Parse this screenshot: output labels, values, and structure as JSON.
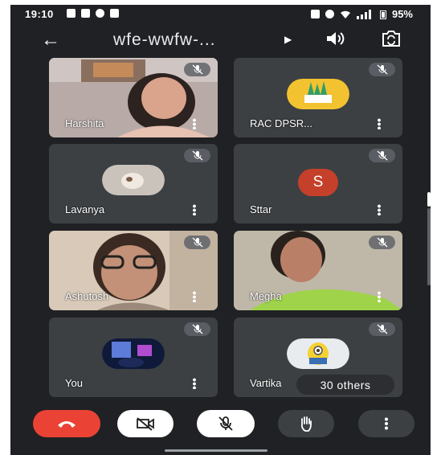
{
  "status_bar": {
    "time": "19:10",
    "battery": "95%"
  },
  "meeting": {
    "title": "wfe-wwfw-..."
  },
  "participants": [
    {
      "name": "Harshita"
    },
    {
      "name": "RAC DPSR..."
    },
    {
      "name": "Lavanya"
    },
    {
      "name": "Sttar",
      "avatar_letter": "S"
    },
    {
      "name": "Ashutosh"
    },
    {
      "name": "Megha"
    },
    {
      "name": "You"
    },
    {
      "name": "Vartika"
    }
  ],
  "others_label": "30 others",
  "colors": {
    "background": "#202124",
    "tile": "#3c4043",
    "end_call": "#ea4335",
    "avatar_s": "#c5402a"
  },
  "icons": [
    "back-arrow-icon",
    "play-icon",
    "speaker-icon",
    "switch-camera-icon",
    "mic-off-icon",
    "more-vert-icon",
    "end-call-icon",
    "camera-off-icon",
    "hand-raise-icon"
  ]
}
